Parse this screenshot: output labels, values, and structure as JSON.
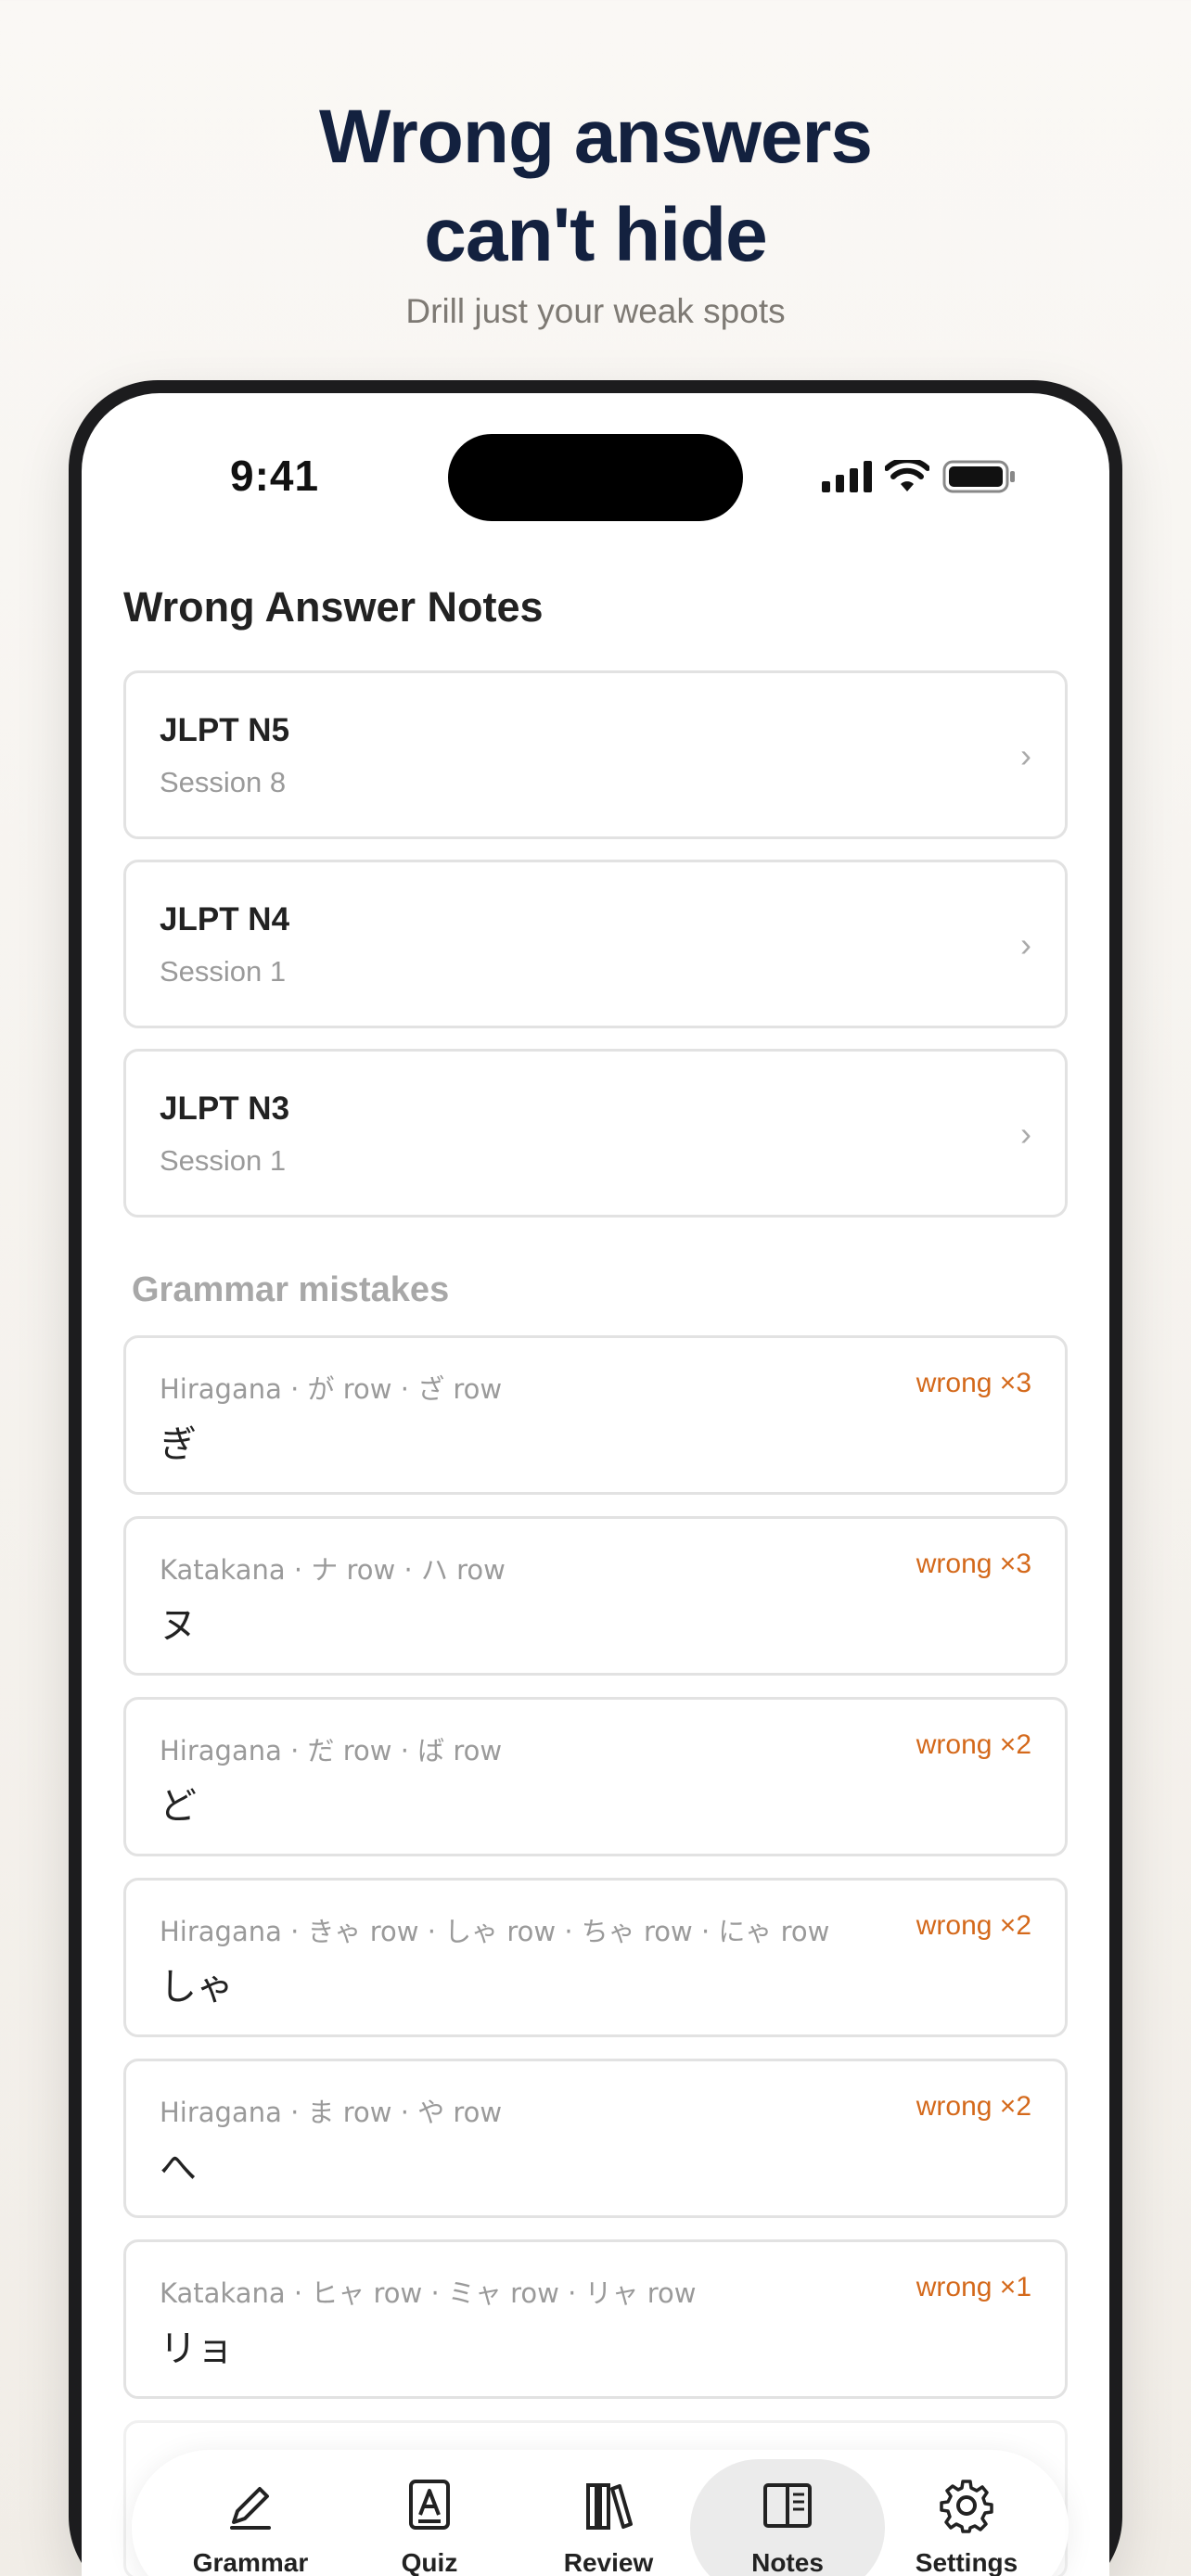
{
  "marketing": {
    "headline_line1": "Wrong answers",
    "headline_line2": "can't hide",
    "subhead": "Drill just your weak spots"
  },
  "status_bar": {
    "time": "9:41"
  },
  "page": {
    "title": "Wrong Answer Notes"
  },
  "sessions": [
    {
      "name": "JLPT N5",
      "sub": "Session 8"
    },
    {
      "name": "JLPT N4",
      "sub": "Session 1"
    },
    {
      "name": "JLPT N3",
      "sub": "Session 1"
    }
  ],
  "grammar_section": {
    "title": "Grammar mistakes",
    "items": [
      {
        "category": "Hiragana · が row · ざ row",
        "kana": "ぎ",
        "count": "wrong ×3"
      },
      {
        "category": "Katakana · ナ row · ハ row",
        "kana": "ヌ",
        "count": "wrong ×3"
      },
      {
        "category": "Hiragana · だ row · ば row",
        "kana": "ど",
        "count": "wrong ×2"
      },
      {
        "category": "Hiragana · きゃ row · しゃ row · ちゃ row · にゃ row",
        "kana": "しゃ",
        "count": "wrong ×2"
      },
      {
        "category": "Hiragana · ま row · や row",
        "kana": "へ",
        "count": "wrong ×2"
      },
      {
        "category": "Katakana · ヒャ row · ミャ row · リャ row",
        "kana": "リョ",
        "count": "wrong ×1"
      }
    ]
  },
  "tabbar": {
    "active": "Notes",
    "tabs": [
      {
        "label": "Grammar",
        "icon": "pen-icon"
      },
      {
        "label": "Quiz",
        "icon": "letter-a-icon"
      },
      {
        "label": "Review",
        "icon": "books-icon"
      },
      {
        "label": "Notes",
        "icon": "notebook-icon"
      },
      {
        "label": "Settings",
        "icon": "gear-icon"
      }
    ]
  }
}
